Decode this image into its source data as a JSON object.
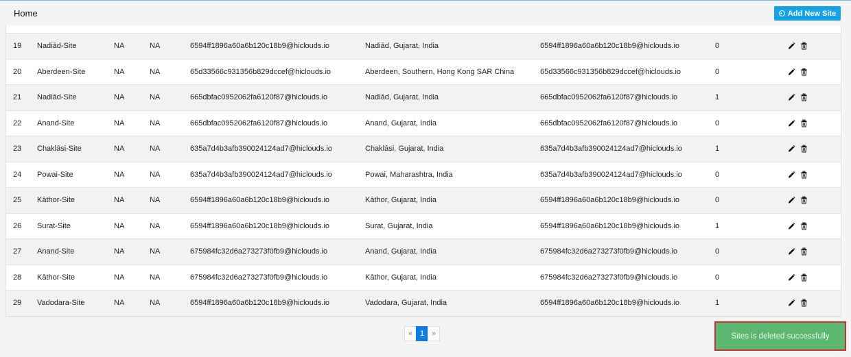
{
  "header": {
    "title": "Home",
    "add_button_label": "Add New Site",
    "add_button_icon": "plus-circle-icon"
  },
  "colors": {
    "accent": "#17a2e6",
    "toast_bg": "#5cb870",
    "toast_border": "#d02f2f",
    "pager_active": "#0d7de0"
  },
  "table": {
    "rows": [
      {
        "idx": "19",
        "name": "Nadiād-Site",
        "col3": "NA",
        "col4": "NA",
        "email": "6594ff1896a60a6b120c18b9@hiclouds.io",
        "location": "Nadiād, Gujarat, India",
        "owner": "6594ff1896a60a6b120c18b9@hiclouds.io",
        "count": "0"
      },
      {
        "idx": "20",
        "name": "Aberdeen-Site",
        "col3": "NA",
        "col4": "NA",
        "email": "65d33566c931356b829dccef@hiclouds.io",
        "location": "Aberdeen, Southern, Hong Kong SAR China",
        "owner": "65d33566c931356b829dccef@hiclouds.io",
        "count": "0"
      },
      {
        "idx": "21",
        "name": "Nadiād-Site",
        "col3": "NA",
        "col4": "NA",
        "email": "665dbfac0952062fa6120f87@hiclouds.io",
        "location": "Nadiād, Gujarat, India",
        "owner": "665dbfac0952062fa6120f87@hiclouds.io",
        "count": "1"
      },
      {
        "idx": "22",
        "name": "Anand-Site",
        "col3": "NA",
        "col4": "NA",
        "email": "665dbfac0952062fa6120f87@hiclouds.io",
        "location": "Anand, Gujarat, India",
        "owner": "665dbfac0952062fa6120f87@hiclouds.io",
        "count": "0"
      },
      {
        "idx": "23",
        "name": "Chaklāsi-Site",
        "col3": "NA",
        "col4": "NA",
        "email": "635a7d4b3afb390024124ad7@hiclouds.io",
        "location": "Chaklāsi, Gujarat, India",
        "owner": "635a7d4b3afb390024124ad7@hiclouds.io",
        "count": "1"
      },
      {
        "idx": "24",
        "name": "Powai-Site",
        "col3": "NA",
        "col4": "NA",
        "email": "635a7d4b3afb390024124ad7@hiclouds.io",
        "location": "Powai, Maharashtra, India",
        "owner": "635a7d4b3afb390024124ad7@hiclouds.io",
        "count": "0"
      },
      {
        "idx": "25",
        "name": "Kāthor-Site",
        "col3": "NA",
        "col4": "NA",
        "email": "6594ff1896a60a6b120c18b9@hiclouds.io",
        "location": "Kāthor, Gujarat, India",
        "owner": "6594ff1896a60a6b120c18b9@hiclouds.io",
        "count": "0"
      },
      {
        "idx": "26",
        "name": "Surat-Site",
        "col3": "NA",
        "col4": "NA",
        "email": "6594ff1896a60a6b120c18b9@hiclouds.io",
        "location": "Surat, Gujarat, India",
        "owner": "6594ff1896a60a6b120c18b9@hiclouds.io",
        "count": "1"
      },
      {
        "idx": "27",
        "name": "Anand-Site",
        "col3": "NA",
        "col4": "NA",
        "email": "675984fc32d6a273273f0fb9@hiclouds.io",
        "location": "Anand, Gujarat, India",
        "owner": "675984fc32d6a273273f0fb9@hiclouds.io",
        "count": "0"
      },
      {
        "idx": "28",
        "name": "Kāthor-Site",
        "col3": "NA",
        "col4": "NA",
        "email": "675984fc32d6a273273f0fb9@hiclouds.io",
        "location": "Kāthor, Gujarat, India",
        "owner": "675984fc32d6a273273f0fb9@hiclouds.io",
        "count": "0"
      },
      {
        "idx": "29",
        "name": "Vadodara-Site",
        "col3": "NA",
        "col4": "NA",
        "email": "6594ff1896a60a6b120c18b9@hiclouds.io",
        "location": "Vadodara, Gujarat, India",
        "owner": "6594ff1896a60a6b120c18b9@hiclouds.io",
        "count": "1"
      }
    ],
    "action_icons": [
      "pencil-icon",
      "trash-icon"
    ]
  },
  "pagination": {
    "prev": "«",
    "current": "1",
    "next": "»"
  },
  "toast": {
    "message": "Sites is deleted successfully"
  }
}
